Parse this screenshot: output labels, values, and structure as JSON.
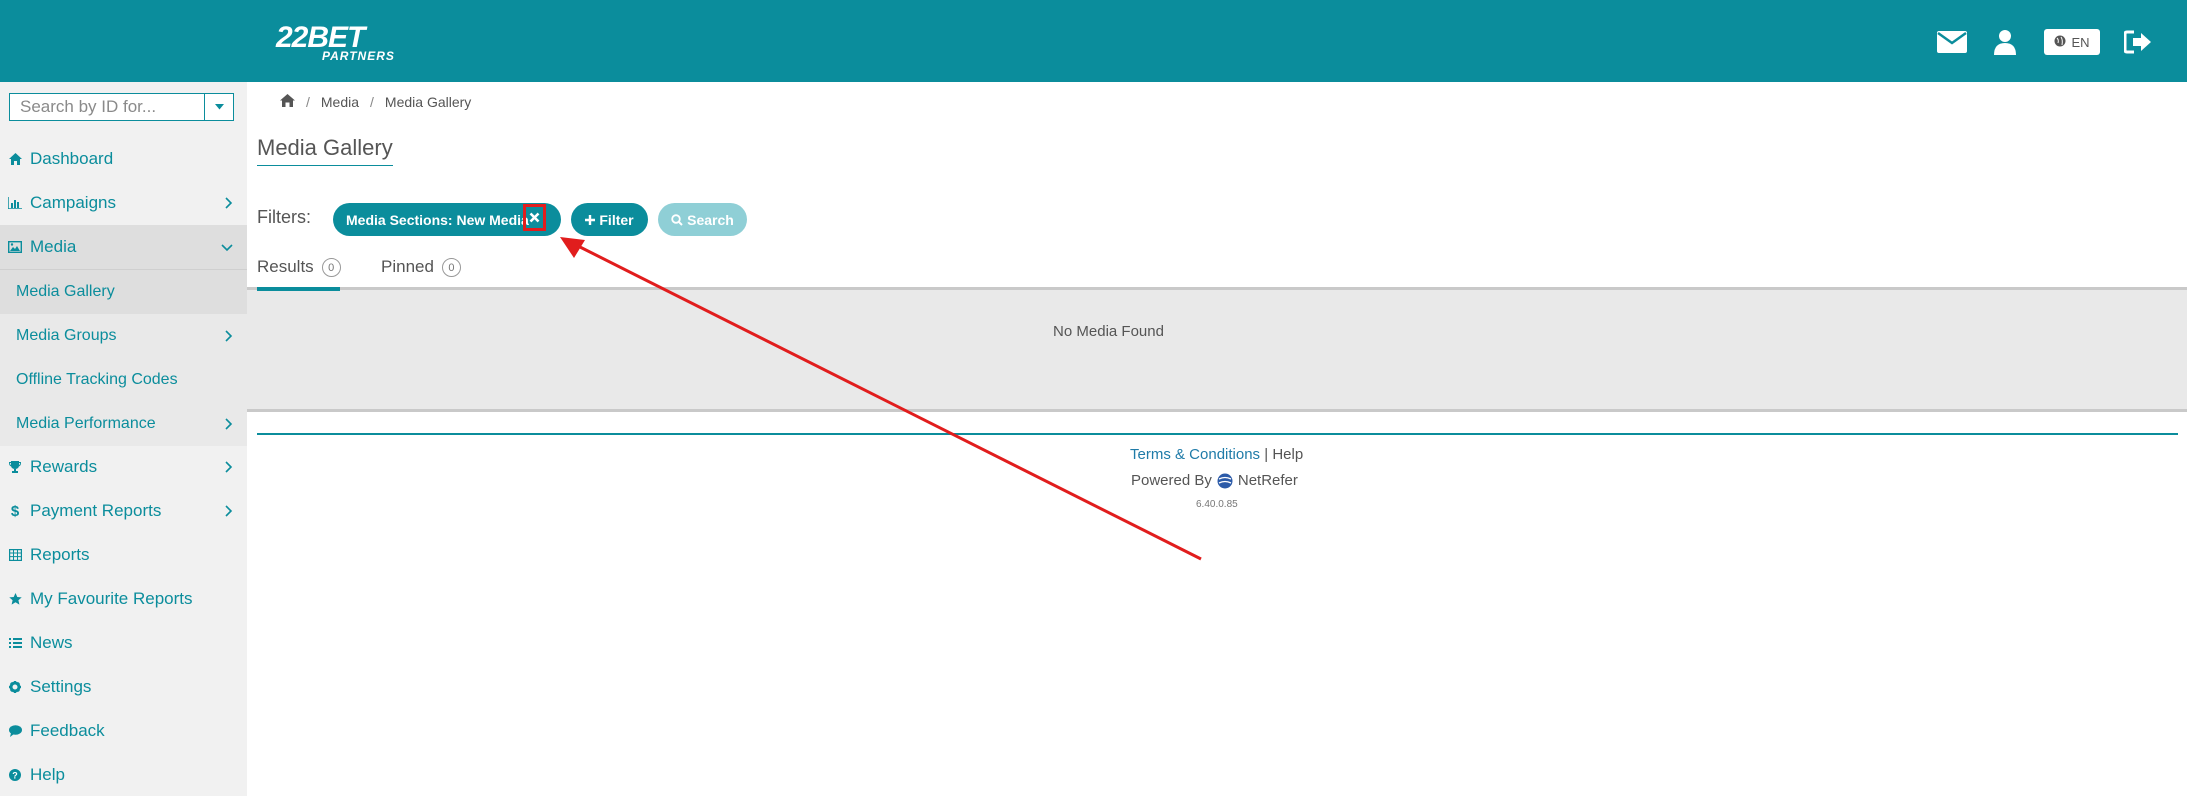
{
  "header": {
    "logo_main": "22BET",
    "logo_sub": "PARTNERS",
    "icons": [
      "envelope-icon",
      "user-icon",
      "globe-icon",
      "sign-out-icon"
    ],
    "language": "EN"
  },
  "sidebar": {
    "search": {
      "placeholder": "Search by ID for..."
    },
    "items": [
      {
        "label": "Dashboard",
        "icon": "home-icon"
      },
      {
        "label": "Campaigns",
        "icon": "bar-chart-icon"
      },
      {
        "label": "Media",
        "icon": "image-icon"
      },
      {
        "label": "Media Gallery"
      },
      {
        "label": "Media Groups"
      },
      {
        "label": "Offline Tracking Codes"
      },
      {
        "label": "Media Performance"
      },
      {
        "label": "Rewards",
        "icon": "trophy-icon"
      },
      {
        "label": "Payment Reports",
        "icon": "dollar-icon"
      },
      {
        "label": "Reports",
        "icon": "table-icon"
      },
      {
        "label": "My Favourite Reports",
        "icon": "star-icon"
      },
      {
        "label": "News",
        "icon": "list-icon"
      },
      {
        "label": "Settings",
        "icon": "gear-icon"
      },
      {
        "label": "Feedback",
        "icon": "comment-icon"
      },
      {
        "label": "Help",
        "icon": "question-icon"
      }
    ]
  },
  "breadcrumb": [
    "Media",
    "Media Gallery"
  ],
  "page": {
    "title": "Media Gallery",
    "filters_label": "Filters:",
    "active_filter": "Media Sections: New Media",
    "filter_button": "Filter",
    "search_button": "Search",
    "tabs": [
      {
        "label": "Results",
        "count": "0"
      },
      {
        "label": "Pinned",
        "count": "0"
      }
    ],
    "empty_message": "No Media Found"
  },
  "footer": {
    "terms": "Terms & Conditions",
    "separator": "|",
    "help": "Help",
    "powered_by": "Powered By",
    "brand": "NetRefer",
    "version": "6.40.0.85"
  },
  "colors": {
    "accent": "#0b8d9c",
    "highlight": "#e11d1d"
  }
}
